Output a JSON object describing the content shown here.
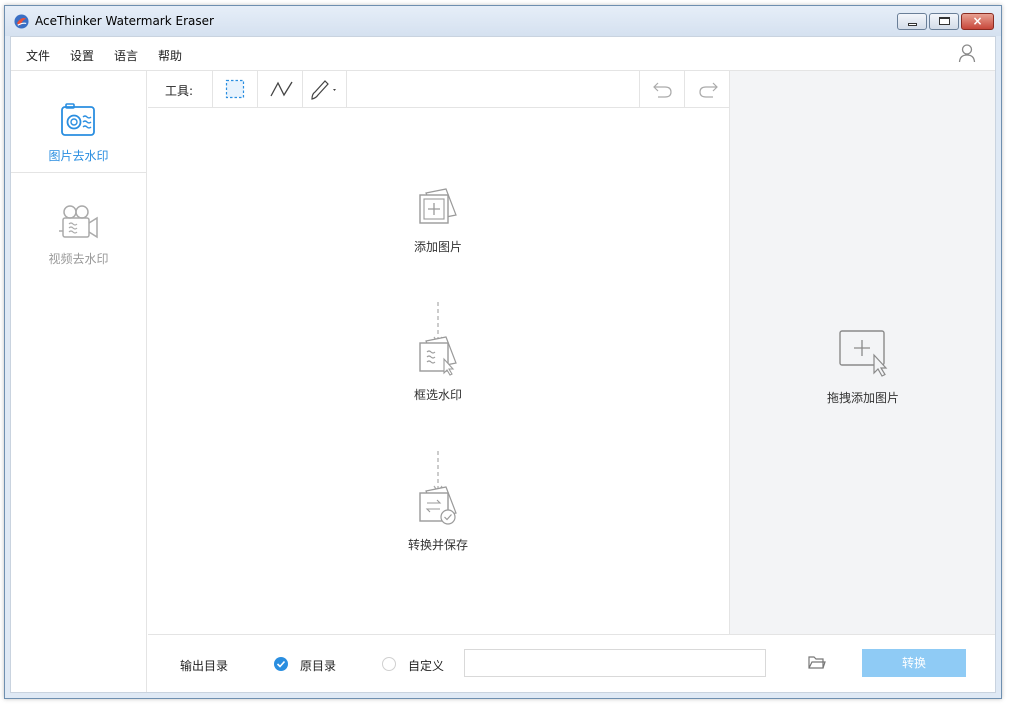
{
  "window": {
    "title": "AceThinker Watermark Eraser",
    "controls": {
      "minimize": "minimize",
      "maximize": "maximize",
      "close": "×"
    }
  },
  "menu": {
    "items": [
      {
        "label": "文件"
      },
      {
        "label": "设置"
      },
      {
        "label": "语言"
      },
      {
        "label": "帮助"
      }
    ]
  },
  "sidebar": {
    "items": [
      {
        "label": "图片去水印",
        "active": true
      },
      {
        "label": "视频去水印",
        "active": false
      }
    ]
  },
  "toolbar": {
    "label": "工具:",
    "tools": [
      "rectangle-select-icon",
      "polyline-icon",
      "brush-icon"
    ],
    "undo": "undo-icon",
    "redo": "redo-icon"
  },
  "workflow": {
    "steps": [
      {
        "label": "添加图片",
        "icon": "add-image-icon"
      },
      {
        "label": "框选水印",
        "icon": "select-watermark-icon"
      },
      {
        "label": "转换并保存",
        "icon": "convert-save-icon"
      }
    ]
  },
  "drop": {
    "label": "拖拽添加图片"
  },
  "output": {
    "label": "输出目录",
    "options": [
      {
        "label": "原目录",
        "selected": true
      },
      {
        "label": "自定义",
        "selected": false
      }
    ],
    "path_value": "",
    "convert_label": "转换"
  },
  "colors": {
    "accent": "#2a8ee0",
    "convert_button": "#8fcbf5",
    "icon_gray": "#9a9a9a",
    "drop_bg": "#f3f4f6"
  }
}
